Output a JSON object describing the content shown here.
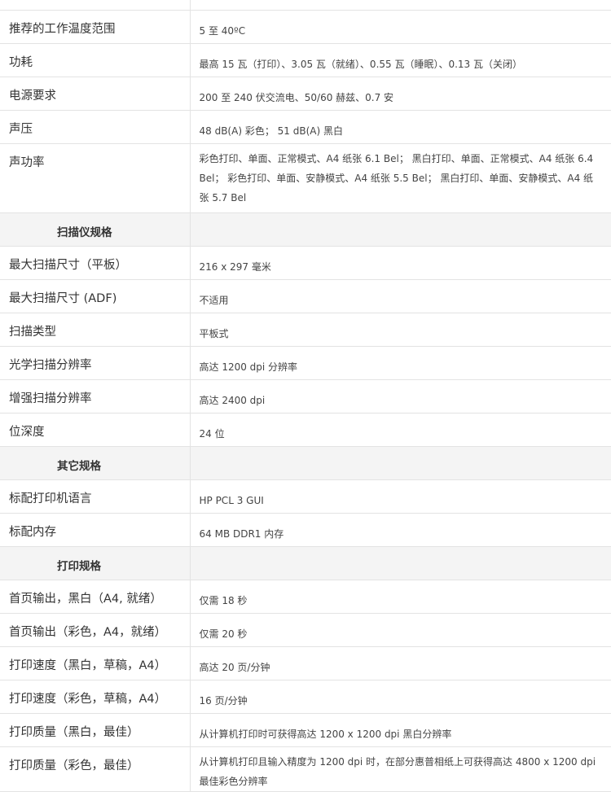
{
  "rows_env": [
    {
      "label": "推荐的工作温度范围",
      "value": "5 至 40ºC"
    },
    {
      "label": "功耗",
      "value": "最高 15 瓦（打印）、3.05 瓦（就绪）、0.55 瓦（睡眠）、0.13 瓦（关闭）"
    },
    {
      "label": "电源要求",
      "value": "200 至 240 伏交流电、50/60 赫兹、0.7 安"
    },
    {
      "label": "声压",
      "value": "48 dB(A) 彩色； 51 dB(A) 黑白"
    },
    {
      "label": "声功率",
      "value": "彩色打印、单面、正常模式、A4 纸张 6.1 Bel； 黑白打印、单面、正常模式、A4 纸张 6.4 Bel； 彩色打印、单面、安静模式、A4 纸张 5.5 Bel； 黑白打印、单面、安静模式、A4 纸张 5.7 Bel"
    }
  ],
  "section_scanner": "扫描仪规格",
  "rows_scanner": [
    {
      "label": "最大扫描尺寸（平板）",
      "value": "216 x 297 毫米"
    },
    {
      "label": "最大扫描尺寸 (ADF)",
      "value": "不适用"
    },
    {
      "label": "扫描类型",
      "value": "平板式"
    },
    {
      "label": "光学扫描分辨率",
      "value": "高达 1200 dpi 分辨率"
    },
    {
      "label": "增强扫描分辨率",
      "value": "高达 2400 dpi"
    },
    {
      "label": "位深度",
      "value": "24 位"
    }
  ],
  "section_other": "其它规格",
  "rows_other": [
    {
      "label": "标配打印机语言",
      "value": "HP PCL 3 GUI"
    },
    {
      "label": "标配内存",
      "value": "64 MB DDR1 内存"
    }
  ],
  "section_print": "打印规格",
  "rows_print": [
    {
      "label": "首页输出，黑白（A4, 就绪）",
      "value": "仅需 18 秒"
    },
    {
      "label": "首页输出（彩色，A4，就绪）",
      "value": "仅需 20 秒"
    },
    {
      "label": "打印速度（黑白，草稿，A4）",
      "value": "高达 20 页/分钟"
    },
    {
      "label": "打印速度（彩色，草稿，A4）",
      "value": "16 页/分钟"
    },
    {
      "label": "打印质量（黑白，最佳）",
      "value": "从计算机打印时可获得高达 1200 x 1200 dpi 黑白分辨率"
    },
    {
      "label": "打印质量（彩色，最佳）",
      "value": "从计算机打印且输入精度为 1200 dpi 时，在部分惠普相纸上可获得高达 4800 x 1200 dpi 最佳彩色分辨率"
    }
  ]
}
